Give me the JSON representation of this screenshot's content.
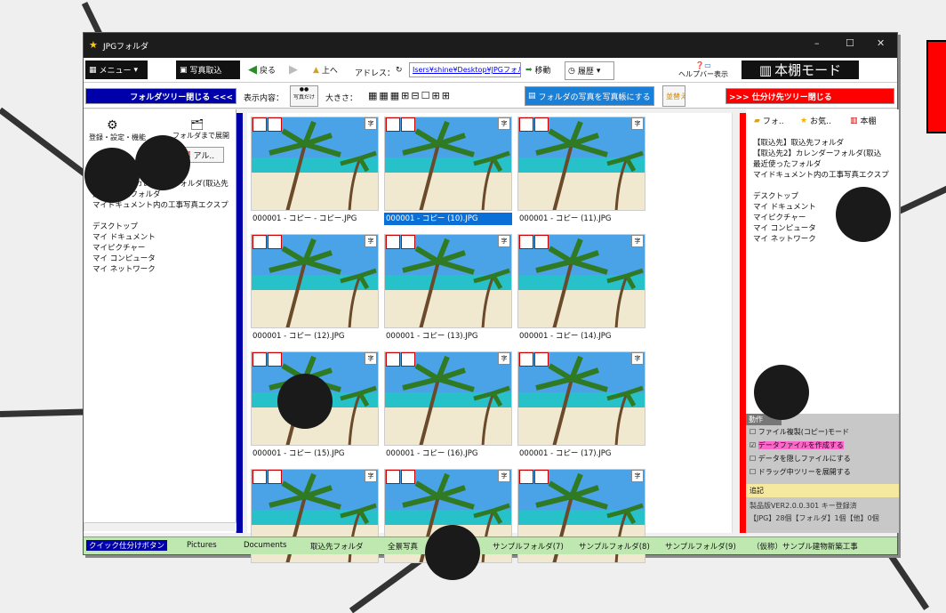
{
  "window": {
    "title": "JPGフォルダ",
    "controls": [
      "–",
      "☐",
      "✕"
    ]
  },
  "toolbar1": {
    "menu": "メニュー",
    "photo_import": "写真取込",
    "back": "戻る",
    "up": "上へ",
    "address_label": "アドレス：",
    "address": "Isers¥shine¥Desktop¥JPGフォルダ",
    "move": "移動",
    "history": "履歴",
    "help": "ヘルプバー表示",
    "bookshelf": "本棚モード"
  },
  "toolbar2": {
    "folder_tree_close": "フォルダツリー閉じる <<<",
    "display_label": "表示内容：",
    "photo_only": "写真だけ",
    "size_label": "大きさ：",
    "make_book": "フォルダの写真を写真帳にする",
    "reorder": "並替え",
    "sort_tree_close": ">>> 仕分け先ツリー閉じる"
  },
  "left_panel": {
    "settings": "登録・設定・機能",
    "expand": "フォルダまで展開",
    "tab_album": "アル..",
    "tree": [
      "【取込先】取込先フォルダ",
      "【取込先2】カレンダーフォルダ(取込先",
      "最近使ったフォルダ",
      "マイドキュメント内の工事写真エクスプ",
      "",
      "デスクトップ",
      "マイ ドキュメント",
      "マイピクチャー",
      "マイ コンピュータ",
      "マイ ネットワーク"
    ]
  },
  "thumbnails": [
    {
      "name": "000001 - コピー - コピー.JPG",
      "selected": false
    },
    {
      "name": "000001 - コピー (10).JPG",
      "selected": true
    },
    {
      "name": "000001 - コピー (11).JPG",
      "selected": false
    },
    {
      "name": "000001 - コピー (12).JPG",
      "selected": false
    },
    {
      "name": "000001 - コピー (13).JPG",
      "selected": false
    },
    {
      "name": "000001 - コピー (14).JPG",
      "selected": false
    },
    {
      "name": "000001 - コピー (15).JPG",
      "selected": false
    },
    {
      "name": "000001 - コピー (16).JPG",
      "selected": false
    },
    {
      "name": "000001 - コピー (17).JPG",
      "selected": false
    },
    {
      "name": "",
      "selected": false
    },
    {
      "name": "",
      "selected": false
    },
    {
      "name": "",
      "selected": false
    }
  ],
  "right_panel": {
    "tabs": [
      "フォ..",
      "お気..",
      "本棚"
    ],
    "tree": [
      "【取込先】取込先フォルダ",
      "【取込先2】カレンダーフォルダ(取込",
      "最近使ったフォルダ",
      "マイドキュメント内の工事写真エクスプ",
      "",
      "デスクトップ",
      "マイ ドキュメント",
      "マイピクチャー",
      "マイ コンピュータ",
      "マイ ネットワーク"
    ],
    "options_title": "動作",
    "options": [
      "ファイル複製(コピー)モード",
      "データファイルを作成する",
      "データを隠しファイルにする",
      "ドラッグ中ツリーを展開する"
    ],
    "memo": "追記",
    "version": "製品版VER2.0.0.301  キー登録済",
    "status": "【JPG】28個【フォルダ】1個【他】0個"
  },
  "bottombar": {
    "quick": "クイック仕分けボタン",
    "items": [
      "Pictures",
      "Documents",
      "取込先フォルダ",
      "全景写真",
      "サンプルフォルダ(7)",
      "サンプルフォルダ(8)",
      "サンプルフォルダ(9)",
      "（仮称）サンプル建物新築工事"
    ]
  }
}
